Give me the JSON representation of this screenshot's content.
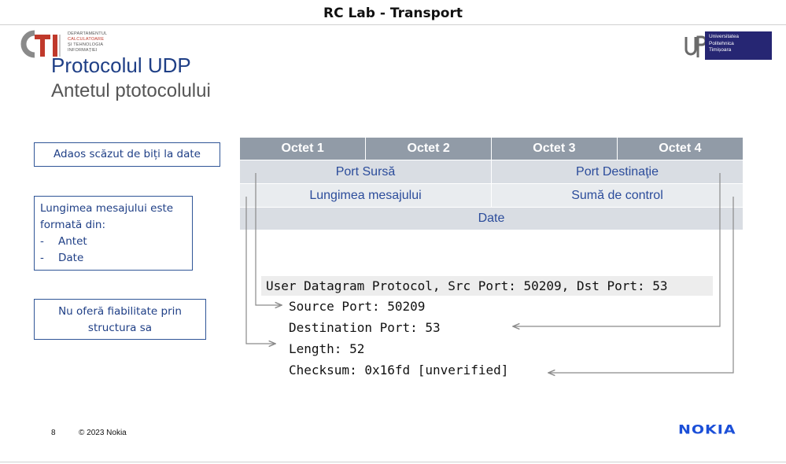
{
  "window": {
    "title": "RC Lab - Transport"
  },
  "logos": {
    "cti": {
      "letters": "CTI",
      "lines": [
        "DEPARTAMENTUL",
        "CALCULATOARE",
        "ȘI TEHNOLOGIA",
        "INFORMAȚIEI"
      ]
    },
    "upt": {
      "mark": "UPT",
      "lines": [
        "Universitatea",
        "Politehnica",
        "Timișoara"
      ]
    }
  },
  "slide": {
    "title": "Protocolul UDP",
    "subtitle": "Antetul ptotocolului"
  },
  "notes": {
    "overhead": "Adaos scăzut de biți la date",
    "length_intro": "Lungimea mesajului este formată din:",
    "length_items": [
      "Antet",
      "Date"
    ],
    "length_bullet": "-",
    "reliability": "Nu oferă fiabilitate prin structura sa"
  },
  "udp_header": {
    "octets": [
      "Octet 1",
      "Octet 2",
      "Octet 3",
      "Octet 4"
    ],
    "row1": [
      "Port Sursă",
      "Port Destinaţie"
    ],
    "row2": [
      "Lungimea mesajului",
      "Sumă de control"
    ],
    "row3": "Date"
  },
  "wireshark": {
    "summary": "User Datagram Protocol, Src Port: 50209, Dst Port: 53",
    "fields": [
      "Source Port: 50209",
      "Destination Port: 53",
      "Length: 52",
      "Checksum: 0x16fd [unverified]"
    ]
  },
  "footer": {
    "page_number": "8",
    "copyright": "© 2023 Nokia",
    "brand": "NOKIA"
  },
  "colors": {
    "title_blue": "#1f3f86",
    "header_gray": "#919ba7",
    "row_light": "#d9dde3",
    "connector": "#8a8a8a",
    "nokia_blue": "#1b4fd8"
  }
}
